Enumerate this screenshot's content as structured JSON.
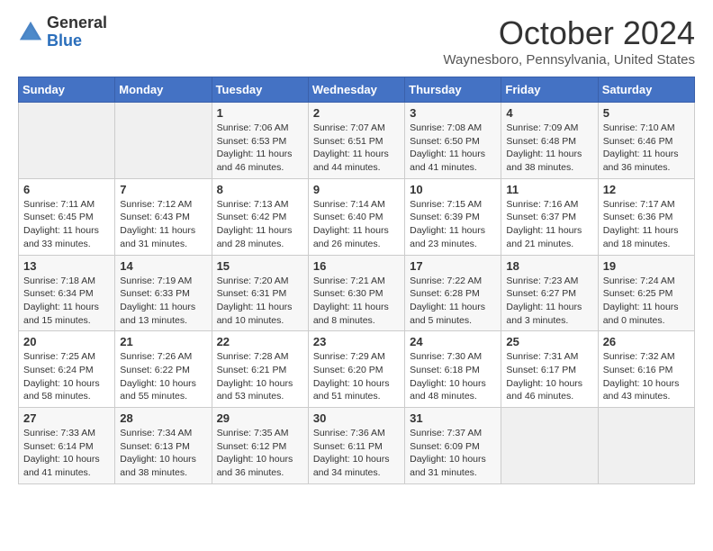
{
  "logo": {
    "general": "General",
    "blue": "Blue"
  },
  "header": {
    "month": "October 2024",
    "location": "Waynesboro, Pennsylvania, United States"
  },
  "days_of_week": [
    "Sunday",
    "Monday",
    "Tuesday",
    "Wednesday",
    "Thursday",
    "Friday",
    "Saturday"
  ],
  "weeks": [
    [
      {
        "day": "",
        "info": ""
      },
      {
        "day": "",
        "info": ""
      },
      {
        "day": "1",
        "info": "Sunrise: 7:06 AM\nSunset: 6:53 PM\nDaylight: 11 hours and 46 minutes."
      },
      {
        "day": "2",
        "info": "Sunrise: 7:07 AM\nSunset: 6:51 PM\nDaylight: 11 hours and 44 minutes."
      },
      {
        "day": "3",
        "info": "Sunrise: 7:08 AM\nSunset: 6:50 PM\nDaylight: 11 hours and 41 minutes."
      },
      {
        "day": "4",
        "info": "Sunrise: 7:09 AM\nSunset: 6:48 PM\nDaylight: 11 hours and 38 minutes."
      },
      {
        "day": "5",
        "info": "Sunrise: 7:10 AM\nSunset: 6:46 PM\nDaylight: 11 hours and 36 minutes."
      }
    ],
    [
      {
        "day": "6",
        "info": "Sunrise: 7:11 AM\nSunset: 6:45 PM\nDaylight: 11 hours and 33 minutes."
      },
      {
        "day": "7",
        "info": "Sunrise: 7:12 AM\nSunset: 6:43 PM\nDaylight: 11 hours and 31 minutes."
      },
      {
        "day": "8",
        "info": "Sunrise: 7:13 AM\nSunset: 6:42 PM\nDaylight: 11 hours and 28 minutes."
      },
      {
        "day": "9",
        "info": "Sunrise: 7:14 AM\nSunset: 6:40 PM\nDaylight: 11 hours and 26 minutes."
      },
      {
        "day": "10",
        "info": "Sunrise: 7:15 AM\nSunset: 6:39 PM\nDaylight: 11 hours and 23 minutes."
      },
      {
        "day": "11",
        "info": "Sunrise: 7:16 AM\nSunset: 6:37 PM\nDaylight: 11 hours and 21 minutes."
      },
      {
        "day": "12",
        "info": "Sunrise: 7:17 AM\nSunset: 6:36 PM\nDaylight: 11 hours and 18 minutes."
      }
    ],
    [
      {
        "day": "13",
        "info": "Sunrise: 7:18 AM\nSunset: 6:34 PM\nDaylight: 11 hours and 15 minutes."
      },
      {
        "day": "14",
        "info": "Sunrise: 7:19 AM\nSunset: 6:33 PM\nDaylight: 11 hours and 13 minutes."
      },
      {
        "day": "15",
        "info": "Sunrise: 7:20 AM\nSunset: 6:31 PM\nDaylight: 11 hours and 10 minutes."
      },
      {
        "day": "16",
        "info": "Sunrise: 7:21 AM\nSunset: 6:30 PM\nDaylight: 11 hours and 8 minutes."
      },
      {
        "day": "17",
        "info": "Sunrise: 7:22 AM\nSunset: 6:28 PM\nDaylight: 11 hours and 5 minutes."
      },
      {
        "day": "18",
        "info": "Sunrise: 7:23 AM\nSunset: 6:27 PM\nDaylight: 11 hours and 3 minutes."
      },
      {
        "day": "19",
        "info": "Sunrise: 7:24 AM\nSunset: 6:25 PM\nDaylight: 11 hours and 0 minutes."
      }
    ],
    [
      {
        "day": "20",
        "info": "Sunrise: 7:25 AM\nSunset: 6:24 PM\nDaylight: 10 hours and 58 minutes."
      },
      {
        "day": "21",
        "info": "Sunrise: 7:26 AM\nSunset: 6:22 PM\nDaylight: 10 hours and 55 minutes."
      },
      {
        "day": "22",
        "info": "Sunrise: 7:28 AM\nSunset: 6:21 PM\nDaylight: 10 hours and 53 minutes."
      },
      {
        "day": "23",
        "info": "Sunrise: 7:29 AM\nSunset: 6:20 PM\nDaylight: 10 hours and 51 minutes."
      },
      {
        "day": "24",
        "info": "Sunrise: 7:30 AM\nSunset: 6:18 PM\nDaylight: 10 hours and 48 minutes."
      },
      {
        "day": "25",
        "info": "Sunrise: 7:31 AM\nSunset: 6:17 PM\nDaylight: 10 hours and 46 minutes."
      },
      {
        "day": "26",
        "info": "Sunrise: 7:32 AM\nSunset: 6:16 PM\nDaylight: 10 hours and 43 minutes."
      }
    ],
    [
      {
        "day": "27",
        "info": "Sunrise: 7:33 AM\nSunset: 6:14 PM\nDaylight: 10 hours and 41 minutes."
      },
      {
        "day": "28",
        "info": "Sunrise: 7:34 AM\nSunset: 6:13 PM\nDaylight: 10 hours and 38 minutes."
      },
      {
        "day": "29",
        "info": "Sunrise: 7:35 AM\nSunset: 6:12 PM\nDaylight: 10 hours and 36 minutes."
      },
      {
        "day": "30",
        "info": "Sunrise: 7:36 AM\nSunset: 6:11 PM\nDaylight: 10 hours and 34 minutes."
      },
      {
        "day": "31",
        "info": "Sunrise: 7:37 AM\nSunset: 6:09 PM\nDaylight: 10 hours and 31 minutes."
      },
      {
        "day": "",
        "info": ""
      },
      {
        "day": "",
        "info": ""
      }
    ]
  ]
}
